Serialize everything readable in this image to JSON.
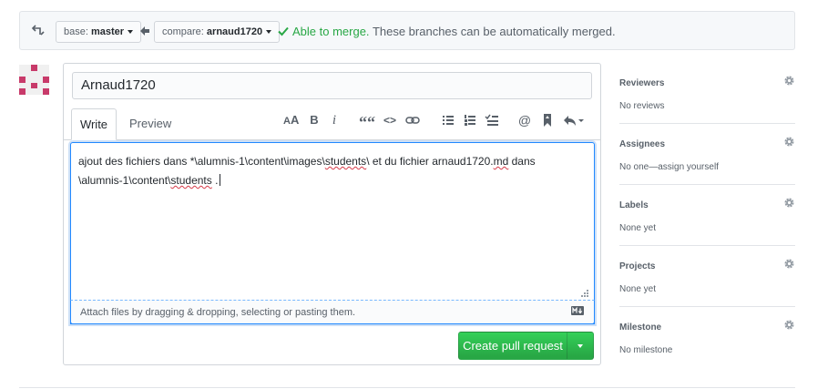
{
  "compare_bar": {
    "base_prefix": "base:",
    "base_branch": "master",
    "compare_prefix": "compare:",
    "compare_branch": "arnaud1720",
    "merge_ok": "Able to merge.",
    "merge_detail": "These branches can be automatically merged."
  },
  "form": {
    "title_value": "Arnaud1720",
    "tabs": {
      "write": "Write",
      "preview": "Preview"
    },
    "toolbar": {
      "header_icon": "text-size-icon",
      "bold_label": "B",
      "italic_label": "i",
      "quote_label": "““",
      "code_label": "<>"
    },
    "body_line1_a": "ajout des fichiers dans  *\\alumnis-1\\content\\images\\",
    "body_line1_b": "students",
    "body_line1_c": "\\ et du fichier arnaud1720.",
    "body_line1_d": "md",
    "body_line1_e": " dans",
    "body_line2_a": "\\alumnis-1\\content\\",
    "body_line2_b": "students",
    "body_line2_c": " .",
    "attach_hint": "Attach files by dragging & dropping, selecting or pasting them.",
    "submit_label": "Create pull request"
  },
  "sidebar": {
    "reviewers": {
      "title": "Reviewers",
      "value": "No reviews"
    },
    "assignees": {
      "title": "Assignees",
      "value": "No one—assign yourself"
    },
    "labels": {
      "title": "Labels",
      "value": "None yet"
    },
    "projects": {
      "title": "Projects",
      "value": "None yet"
    },
    "milestone": {
      "title": "Milestone",
      "value": "No milestone"
    }
  },
  "colors": {
    "accent_green": "#28a745",
    "focus_blue": "#2188ff",
    "avatar_pink": "#c83a6a"
  }
}
